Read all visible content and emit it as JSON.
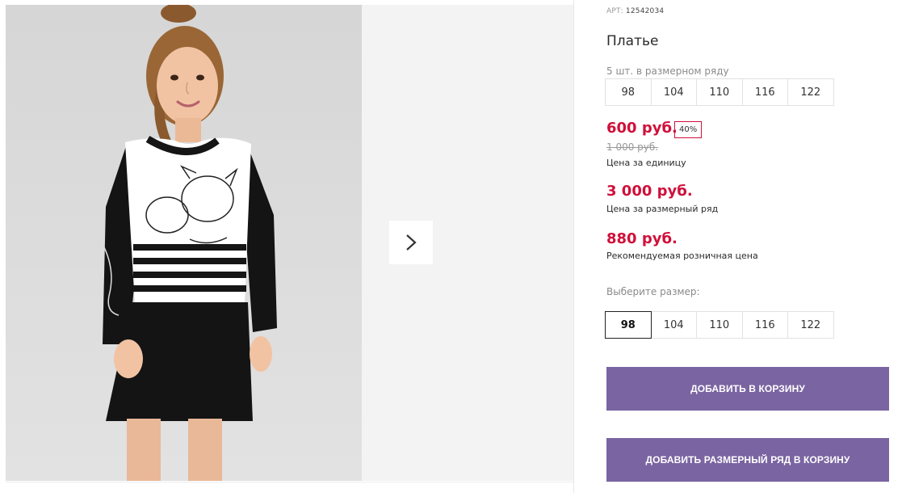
{
  "gallery": {
    "photo_alt": "Фото товара",
    "next_icon": "chevron-right-icon"
  },
  "product": {
    "art_label": "АРТ:",
    "art_number": "12542034",
    "title": "Платье",
    "run_note": "5 шт. в размерном ряду",
    "run_sizes": [
      "98",
      "104",
      "110",
      "116",
      "122"
    ],
    "unit_price": "600 руб.",
    "discount_badge": "40%",
    "old_price": "1 000 руб.",
    "unit_price_caption": "Цена за единицу",
    "run_price": "3 000 руб.",
    "run_price_caption": "Цена за размерный ряд",
    "retail_price": "880 руб.",
    "retail_price_caption": "Рекомендуемая розничная цена",
    "choose_size_label": "Выберите размер:",
    "size_options": [
      "98",
      "104",
      "110",
      "116",
      "122"
    ],
    "selected_size": "98"
  },
  "actions": {
    "add_to_cart": "ДОБАВИТЬ В КОРЗИНУ",
    "add_run_to_cart": "ДОБАВИТЬ РАЗМЕРНЫЙ РЯД В КОРЗИНУ"
  },
  "colors": {
    "price_red": "#d0103a",
    "button_purple": "#7a64a1"
  }
}
